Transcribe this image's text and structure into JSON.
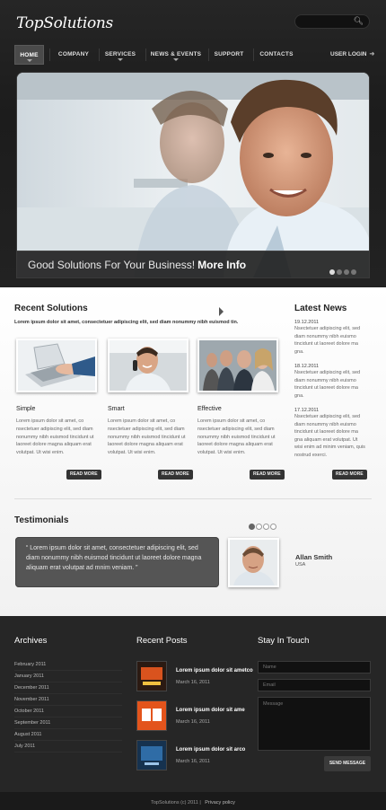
{
  "header": {
    "logo": "TopSolutions",
    "search_icon": "search-icon",
    "nav": [
      {
        "label": "HOME",
        "active": true
      },
      {
        "label": "COMPANY"
      },
      {
        "label": "SERVICES"
      },
      {
        "label": "NEWS & EVENTS"
      },
      {
        "label": "SUPPORT"
      },
      {
        "label": "CONTACTS"
      }
    ],
    "user_login": "USER LOGIN",
    "login_icon": "login-arrow-icon"
  },
  "slider": {
    "caption": "Good Solutions For Your Business!",
    "link": "More Info",
    "dots_total": 4,
    "dots_active": 1
  },
  "solutions": {
    "title": "Recent Solutions",
    "intro": "Lorem ipsum dolor sit amet, consectetuer adipiscing elit, sed diam nonummy nibh euismod tin.",
    "cards": [
      {
        "title": "Simple",
        "body": "Lorem ipsum dolor sit amet, co nsectetuer adipiscing elit, sed diam nonummy nibh euismod tincidunt ut laoreet dolore magna aliquam erat volutpat. Ut wisi enim.",
        "button": "READ MORE"
      },
      {
        "title": "Smart",
        "body": "Lorem ipsum dolor sit amet, co nsectetuer adipiscing elit, sed diam nonummy nibh euismod tincidunt ut laoreet dolore magna aliquam erat volutpat. Ut wisi enim.",
        "button": "READ MORE"
      },
      {
        "title": "Effective",
        "body": "Lorem ipsum dolor sit amet, co nsectetuer adipiscing elit, sed diam nonummy nibh euismod tincidunt ut laoreet dolore magna aliquam erat volutpat. Ut wisi enim.",
        "button": "READ MORE"
      }
    ]
  },
  "news": {
    "title": "Latest News",
    "items": [
      {
        "date": "19.12.2011",
        "text": "Nsectetuer adipiscing elit, sed diam nonummy nibh euismo tincidunt ut laoreet dolore ma gna."
      },
      {
        "date": "18.12.2011",
        "text": "Nsectetuer adipiscing elit, sed diam nonummy nibh euismo tincidunt ut laoreet dolore ma gna."
      },
      {
        "date": "17.12.2011",
        "text": "Nsectetuer adipiscing elit, sed diam nonummy nibh euismo tincidunt ut laoreet dolore ma gna aliquam erat volutpat. Ut wisi enim ad minim veniam, quis nostrud exerci."
      }
    ],
    "button": "READ MORE"
  },
  "testimonials": {
    "title": "Testimonials",
    "quote": "“ Lorem ipsum dolor sit amet, consectetuer adipiscing elit, sed diam nonummy nibh euismod tincidunt ut laoreet dolore magna aliquam erat volutpat ad mnim veniam. ”",
    "name": "Allan Smith",
    "country": "USA"
  },
  "footer": {
    "archives_title": "Archives",
    "archives": [
      "February 2011",
      "January 2011",
      "December 2011",
      "November 2011",
      "October 2011",
      "September 2011",
      "August 2011",
      "July 2011"
    ],
    "posts_title": "Recent Posts",
    "posts": [
      {
        "title": "Lorem ipsum dolor sit ametco",
        "date": "March 16, 2011"
      },
      {
        "title": "Lorem ipsum dolor sit ame",
        "date": "March 16, 2011"
      },
      {
        "title": "Lorem ipsum dolor sit arco",
        "date": "March 16, 2011"
      }
    ],
    "contact_title": "Stay In Touch",
    "name_placeholder": "Name",
    "email_placeholder": "Email",
    "message_placeholder": "Message",
    "send": "SEND MESSAGE"
  },
  "bottom": {
    "copyright": "TopSolutions (c) 2011 |",
    "privacy": "Privacy policy"
  },
  "colors": {
    "dark_bg": "#222222",
    "content_bg": "#ffffff",
    "button": "#333333"
  }
}
